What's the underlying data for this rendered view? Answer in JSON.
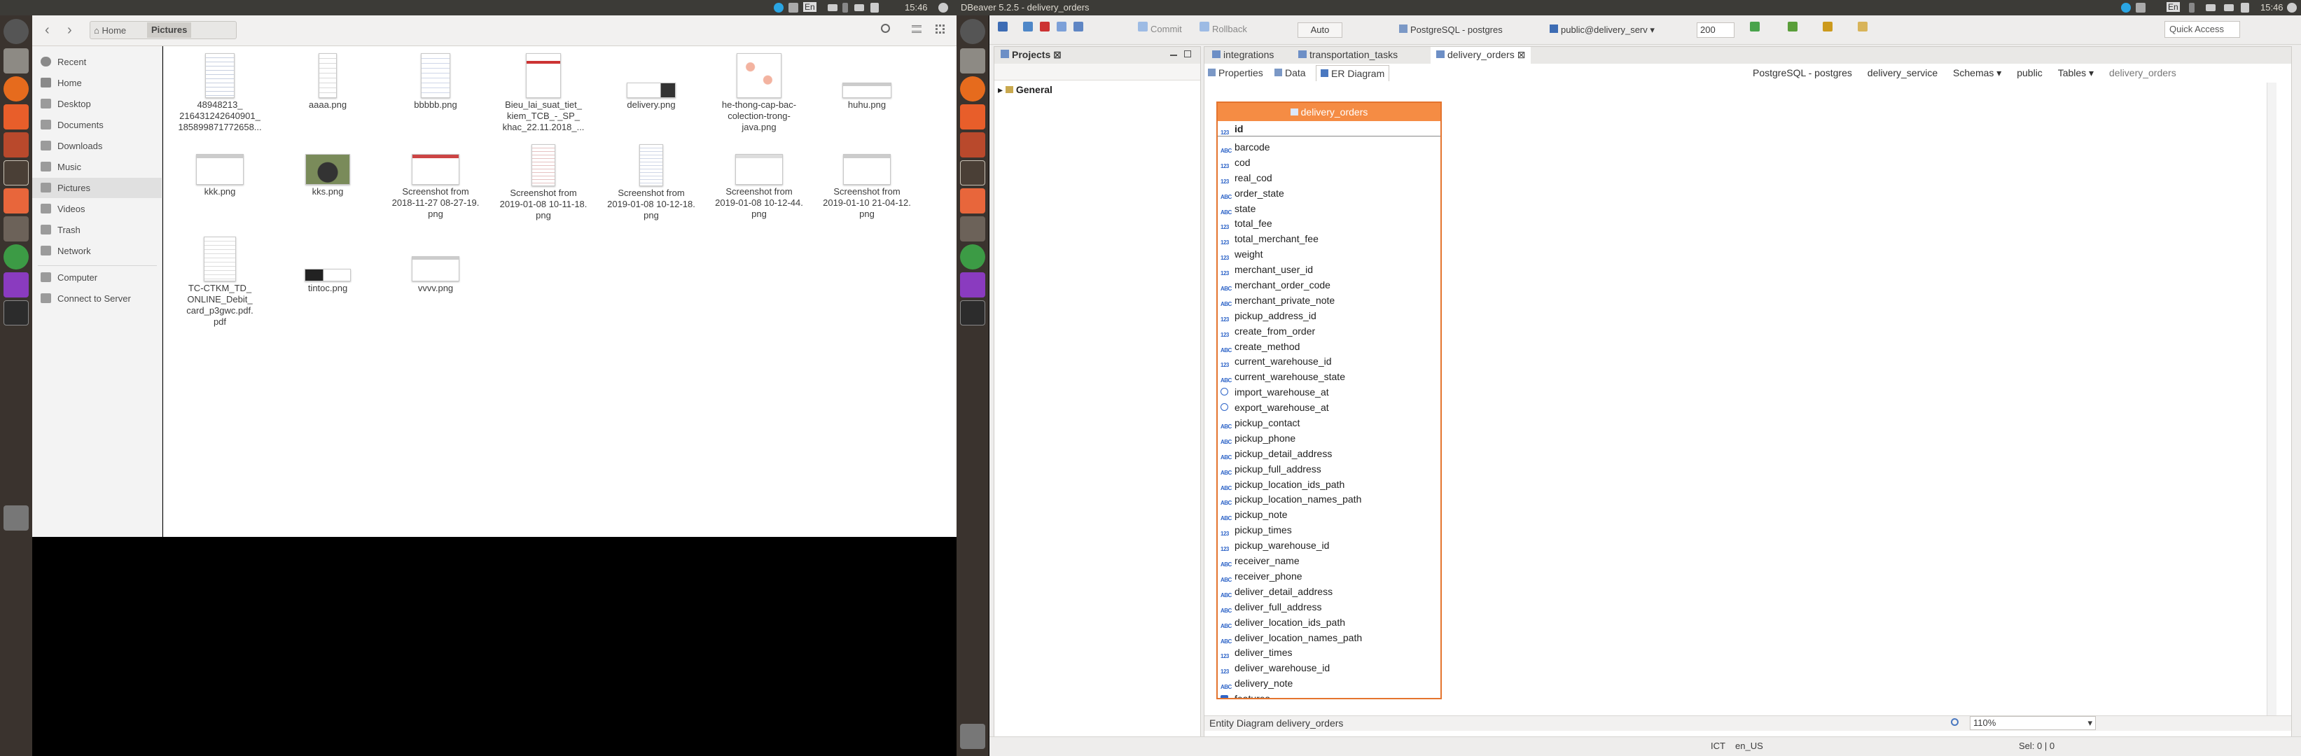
{
  "top_panel_left": {
    "time": "15:46",
    "keyboard": "En"
  },
  "top_panel_right": {
    "app_title": "DBeaver 5.2.5 - delivery_orders",
    "time": "15:46",
    "keyboard": "En"
  },
  "file_manager": {
    "breadcrumb": {
      "home": "Home",
      "current": "Pictures"
    },
    "sidebar": [
      {
        "label": "Recent",
        "icon": "clock-icon"
      },
      {
        "label": "Home",
        "icon": "home-icon"
      },
      {
        "label": "Desktop",
        "icon": "folder-icon"
      },
      {
        "label": "Documents",
        "icon": "folder-icon"
      },
      {
        "label": "Downloads",
        "icon": "folder-icon"
      },
      {
        "label": "Music",
        "icon": "folder-icon"
      },
      {
        "label": "Pictures",
        "icon": "folder-icon",
        "selected": true
      },
      {
        "label": "Videos",
        "icon": "folder-icon"
      },
      {
        "label": "Trash",
        "icon": "trash-icon"
      },
      {
        "label": "Network",
        "icon": "network-icon"
      },
      {
        "label": "Computer",
        "icon": "computer-icon"
      },
      {
        "label": "Connect to Server",
        "icon": "server-icon"
      }
    ],
    "files": [
      "48948213_\n216431242640901_\n185899871772658...",
      "aaaa.png",
      "bbbbb.png",
      "Bieu_lai_suat_tiet_\nkiem_TCB_-_SP_\nkhac_22.11.2018_...",
      "delivery.png",
      "he-thong-cap-bac-\ncolection-trong-\njava.png",
      "huhu.png",
      "kkk.png",
      "kks.png",
      "Screenshot from\n2018-11-27 08-27-19.\npng",
      "Screenshot from\n2019-01-08 10-11-18.\npng",
      "Screenshot from\n2019-01-08 10-12-18.\npng",
      "Screenshot from\n2019-01-08 10-12-44.\npng",
      "Screenshot from\n2019-01-10 21-04-12.\npng",
      "TC-CTKM_TD_\nONLINE_Debit_\ncard_p3gwc.pdf.\npdf",
      "tintoc.png",
      "vvvv.png"
    ]
  },
  "dbeaver": {
    "toolbar": {
      "commit": "Commit",
      "rollback": "Rollback",
      "mode": "Auto",
      "connection": "PostgreSQL - postgres",
      "schema": "public@delivery_serv",
      "limit": "200",
      "quick_access": "Quick Access"
    },
    "projects_tab": "Projects",
    "project_item": "General",
    "editor_tabs": [
      "integrations",
      "transportation_tasks",
      "delivery_orders"
    ],
    "subtabs": [
      "Properties",
      "Data",
      "ER Diagram"
    ],
    "nav_breadcrumb": [
      "PostgreSQL - postgres",
      "delivery_service",
      "Schemas",
      "public",
      "Tables",
      "delivery_orders"
    ],
    "entity": {
      "name": "delivery_orders",
      "pk": "id",
      "columns": [
        {
          "name": "barcode",
          "type": "abc"
        },
        {
          "name": "cod",
          "type": "123"
        },
        {
          "name": "real_cod",
          "type": "123"
        },
        {
          "name": "order_state",
          "type": "abc"
        },
        {
          "name": "state",
          "type": "abc"
        },
        {
          "name": "total_fee",
          "type": "123"
        },
        {
          "name": "total_merchant_fee",
          "type": "123"
        },
        {
          "name": "weight",
          "type": "123"
        },
        {
          "name": "merchant_user_id",
          "type": "123"
        },
        {
          "name": "merchant_order_code",
          "type": "abc"
        },
        {
          "name": "merchant_private_note",
          "type": "abc"
        },
        {
          "name": "pickup_address_id",
          "type": "123"
        },
        {
          "name": "create_from_order",
          "type": "123"
        },
        {
          "name": "create_method",
          "type": "abc"
        },
        {
          "name": "current_warehouse_id",
          "type": "123"
        },
        {
          "name": "current_warehouse_state",
          "type": "abc"
        },
        {
          "name": "import_warehouse_at",
          "type": "clock"
        },
        {
          "name": "export_warehouse_at",
          "type": "clock"
        },
        {
          "name": "pickup_contact",
          "type": "abc"
        },
        {
          "name": "pickup_phone",
          "type": "abc"
        },
        {
          "name": "pickup_detail_address",
          "type": "abc"
        },
        {
          "name": "pickup_full_address",
          "type": "abc"
        },
        {
          "name": "pickup_location_ids_path",
          "type": "abc"
        },
        {
          "name": "pickup_location_names_path",
          "type": "abc"
        },
        {
          "name": "pickup_note",
          "type": "abc"
        },
        {
          "name": "pickup_times",
          "type": "123"
        },
        {
          "name": "pickup_warehouse_id",
          "type": "123"
        },
        {
          "name": "receiver_name",
          "type": "abc"
        },
        {
          "name": "receiver_phone",
          "type": "abc"
        },
        {
          "name": "deliver_detail_address",
          "type": "abc"
        },
        {
          "name": "deliver_full_address",
          "type": "abc"
        },
        {
          "name": "deliver_location_ids_path",
          "type": "abc"
        },
        {
          "name": "deliver_location_names_path",
          "type": "abc"
        },
        {
          "name": "deliver_times",
          "type": "123"
        },
        {
          "name": "deliver_warehouse_id",
          "type": "123"
        },
        {
          "name": "delivery_note",
          "type": "abc"
        },
        {
          "name": "features",
          "type": "json"
        }
      ]
    },
    "bottom_bar": {
      "left": "Entity Diagram",
      "entity": "delivery_orders",
      "zoom": "110%"
    },
    "status_bar": {
      "tz": "ICT",
      "locale": "en_US",
      "sel": "Sel: 0 | 0"
    }
  }
}
